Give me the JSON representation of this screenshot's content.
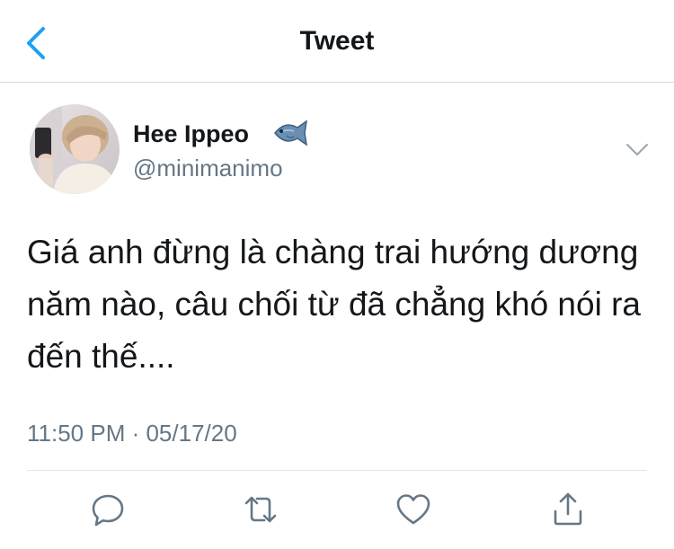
{
  "nav": {
    "title": "Tweet",
    "back_icon": "chevron-left-icon"
  },
  "tweet": {
    "author": {
      "display_name": "Hee Ippeo",
      "emoji_icon": "fish-icon",
      "handle": "@minimanimo"
    },
    "text": "Giá anh đừng là chàng trai hướng dương năm nào, câu chối từ đã chẳng khó nói ra đến thế....",
    "timestamp": "11:50 PM · 05/17/20"
  },
  "actions": [
    "reply-icon",
    "retweet-icon",
    "like-icon",
    "share-icon"
  ],
  "colors": {
    "accent": "#1da1f2",
    "secondary_text": "#657786",
    "primary_text": "#14171a",
    "divider": "#e1e8ed"
  }
}
